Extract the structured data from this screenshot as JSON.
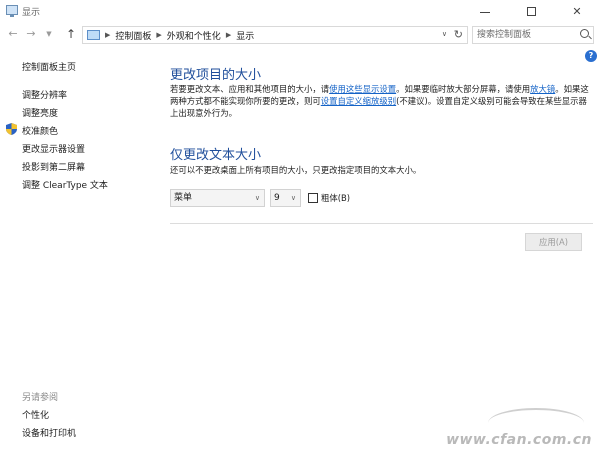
{
  "window": {
    "title": "显示"
  },
  "address": {
    "crumbs": [
      "控制面板",
      "外观和个性化",
      "显示"
    ],
    "search_placeholder": "搜索控制面板"
  },
  "sidebar": {
    "home": "控制面板主页",
    "items": [
      {
        "label": "调整分辨率"
      },
      {
        "label": "调整亮度"
      },
      {
        "label": "校准颜色"
      },
      {
        "label": "更改显示器设置"
      },
      {
        "label": "投影到第二屏幕"
      },
      {
        "label": "调整 ClearType 文本"
      }
    ],
    "see_also_label": "另请参阅",
    "see_also": [
      {
        "label": "个性化"
      },
      {
        "label": "设备和打印机"
      }
    ]
  },
  "main": {
    "heading1": "更改项目的大小",
    "para1_part1": "若要更改文本、应用和其他项目的大小，请",
    "para1_link1": "使用这些显示设置",
    "para1_part2": "。如果要临时放大部分屏幕，请使用",
    "para1_link2": "放大镜",
    "para1_part3": "。如果这两种方式都不能实现你所要的更改，则可",
    "para1_link3": "设置自定义缩放级别",
    "para1_part4": "(不建议)。设置自定义级别可能会导致在某些显示器上出现意外行为。",
    "heading2": "仅更改文本大小",
    "para2": "还可以不更改桌面上所有项目的大小，只更改指定项目的文本大小。",
    "item_select": "菜单",
    "size_select": "9",
    "bold_label": "粗体(B)",
    "apply_label": "应用(A)"
  },
  "watermark": {
    "text": "www.cfan.com.cn"
  },
  "colors": {
    "heading": "#1f4e9b",
    "link": "#1463c7"
  },
  "icons": {
    "back": "arrow-left-icon",
    "forward": "arrow-right-icon",
    "up": "arrow-up-icon",
    "refresh": "refresh-icon",
    "search": "search-icon",
    "help": "help-icon",
    "shield": "uac-shield-icon"
  }
}
